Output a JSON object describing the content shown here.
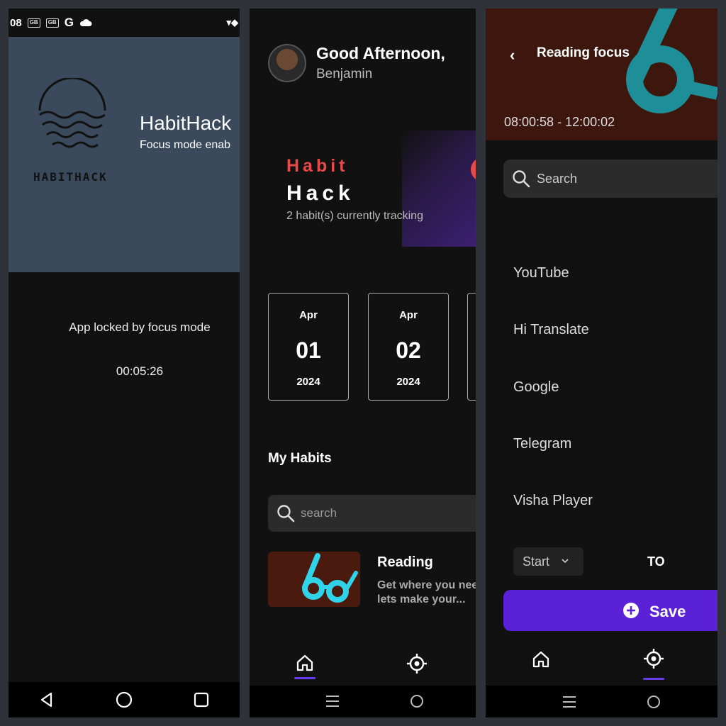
{
  "colors": {
    "accent": "#5b21d6",
    "brand_red": "#e84a4a",
    "panel_bg": "#111111",
    "splash_bg": "#3a4a5c",
    "header_brown": "#3d170d"
  },
  "screen1": {
    "status_time": "08",
    "status_icon_1": "GB",
    "status_icon_2": "GB",
    "status_google": "G",
    "status_right": "▾◆",
    "logo_text": "HABITHACK",
    "app_name": "HabitHack",
    "app_subtitle": "Focus mode enab",
    "locked_message": "App locked by focus mode",
    "timer": "00:05:26",
    "nav_icons": [
      "back-icon",
      "home-circle-icon",
      "recents-icon"
    ]
  },
  "screen2": {
    "greeting": "Good Afternoon,",
    "user_name": "Benjamin",
    "brand_word1": "Habit",
    "brand_word2": "Hack",
    "tracking_text": "2 habit(s) currently tracking",
    "dates": [
      {
        "month": "Apr",
        "day": "01",
        "year": "2024"
      },
      {
        "month": "Apr",
        "day": "02",
        "year": "2024"
      }
    ],
    "section_title": "My Habits",
    "search_placeholder": "search",
    "habit": {
      "title": "Reading",
      "desc_line1": "Get where you nee",
      "desc_line2": "lets make your..."
    },
    "bottom_nav": [
      "home-icon",
      "focus-target-icon"
    ]
  },
  "screen3": {
    "title": "Reading focus",
    "time_range": "08:00:58 - 12:00:02",
    "search_placeholder": "Search",
    "apps": [
      "YouTube",
      "Hi Translate",
      "Google",
      "Telegram",
      "Visha Player"
    ],
    "start_label": "Start",
    "to_label": "TO",
    "save_label": "Save",
    "bottom_nav": [
      "home-icon",
      "focus-target-icon"
    ]
  }
}
